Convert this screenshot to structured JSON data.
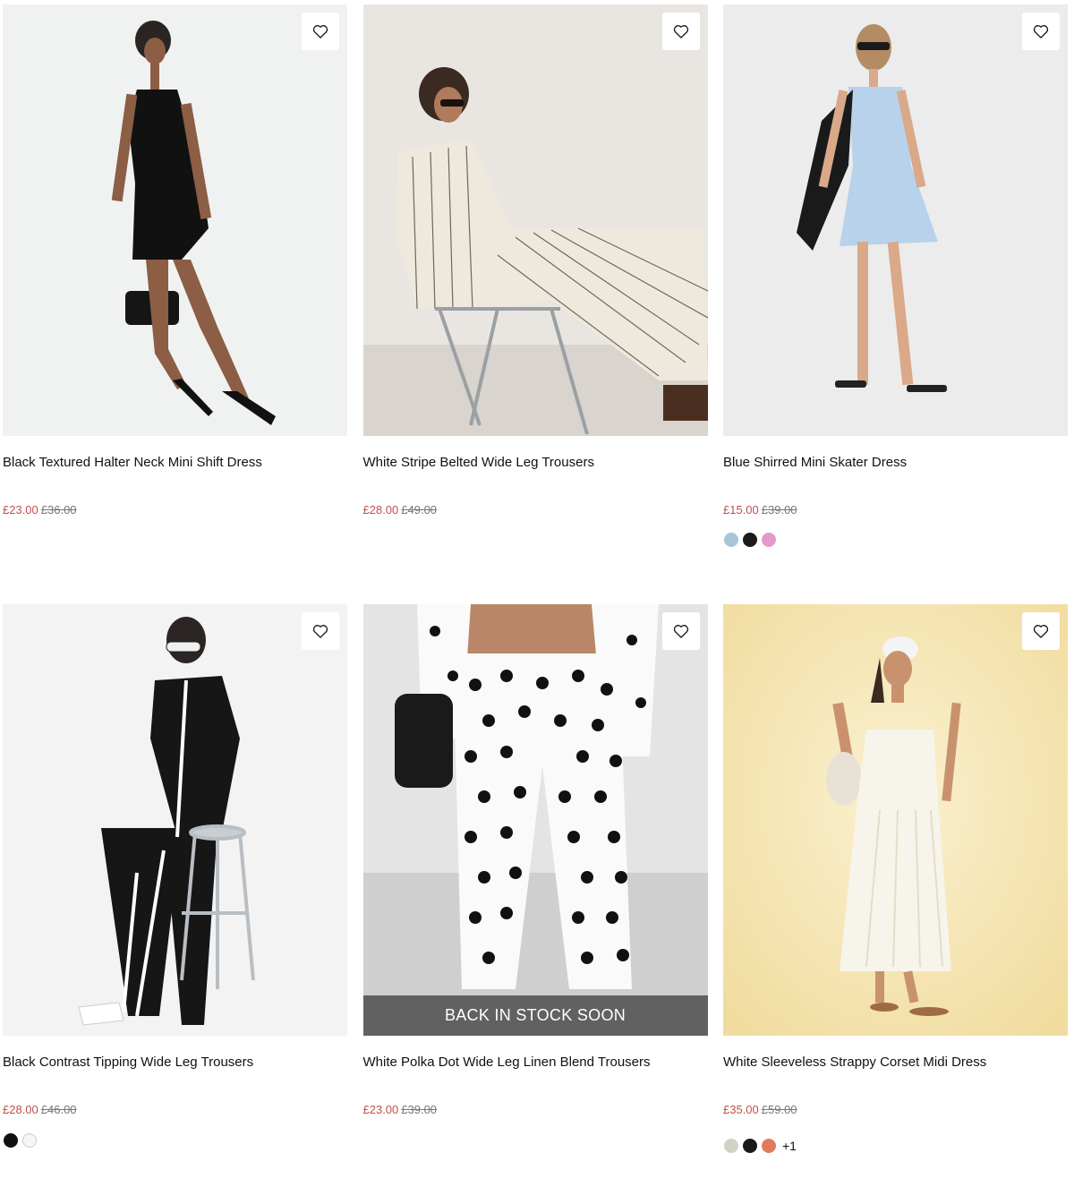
{
  "products": [
    {
      "name": "Black Textured Halter Neck Mini Shift Dress",
      "price": "£23.00",
      "was": "£36.00",
      "swatches": [],
      "more": ""
    },
    {
      "name": "White Stripe Belted Wide Leg Trousers",
      "price": "£28.00",
      "was": "£49.00",
      "swatches": [],
      "more": ""
    },
    {
      "name": "Blue Shirred Mini Skater Dress",
      "price": "£15.00",
      "was": "£39.00",
      "swatches": [
        "#a9c5d8",
        "#1a1a1a",
        "#e39acb"
      ],
      "more": ""
    },
    {
      "name": "Black Contrast Tipping Wide Leg Trousers",
      "price": "£28.00",
      "was": "£46.00",
      "swatches": [
        "#111111",
        "#f5f5f5"
      ],
      "more": ""
    },
    {
      "name": "White Polka Dot Wide Leg Linen Blend Trousers",
      "price": "£23.00",
      "was": "£39.00",
      "banner": "BACK IN STOCK SOON",
      "swatches": [],
      "more": ""
    },
    {
      "name": "White Sleeveless Strappy Corset Midi Dress",
      "price": "£35.00",
      "was": "£59.00",
      "swatches": [
        "#cfd3c5",
        "#1a1a1a",
        "#e07a5f"
      ],
      "more": "+1"
    }
  ],
  "icons": {
    "wishlist": "heart-outline-icon"
  },
  "colors": {
    "sale": "#c0504d",
    "was": "#777777"
  }
}
